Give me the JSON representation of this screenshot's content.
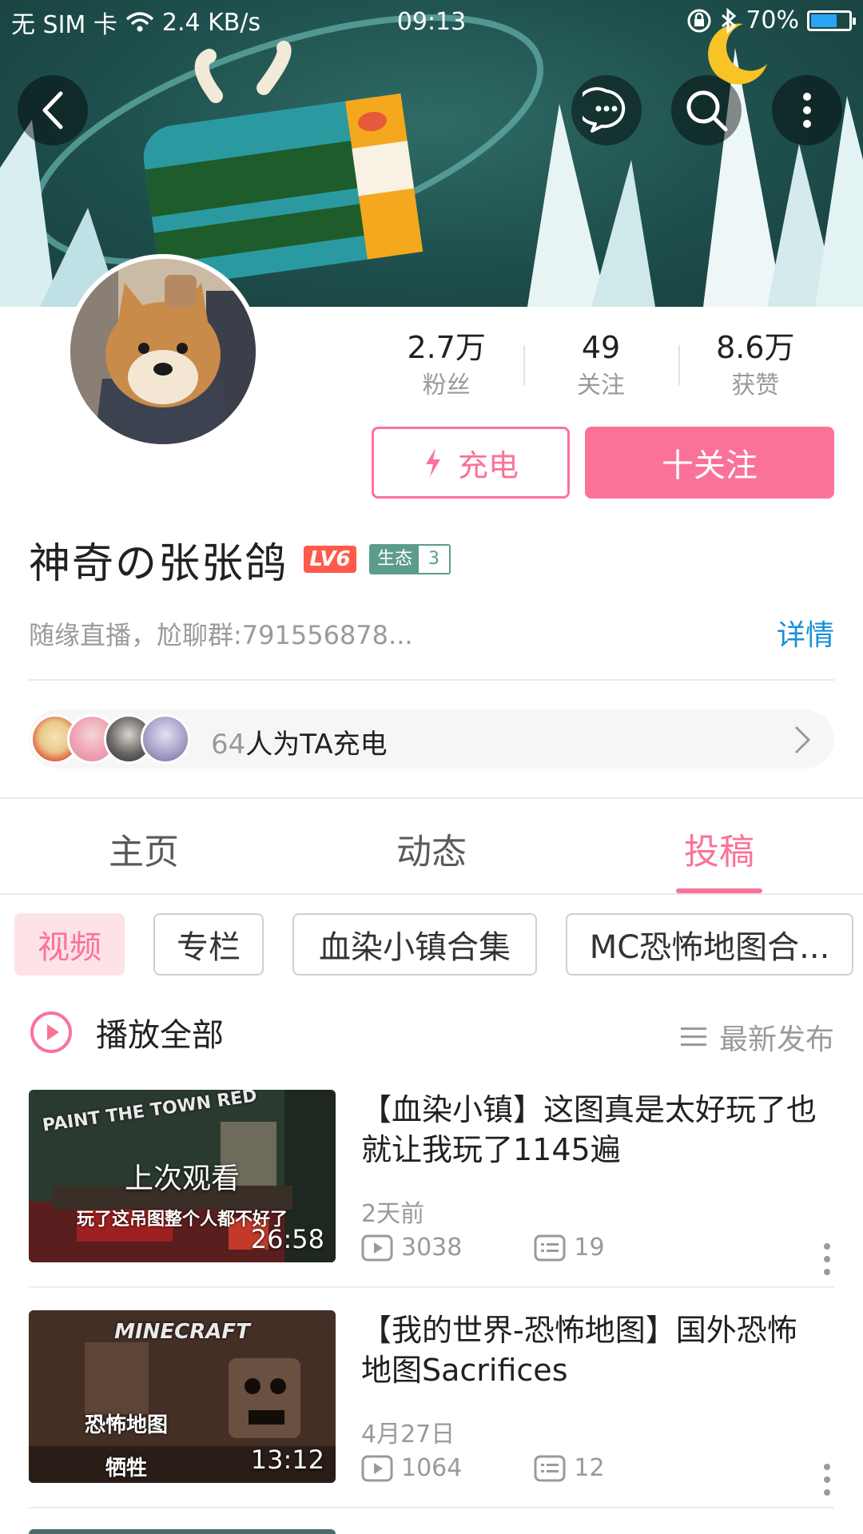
{
  "status_bar": {
    "carrier": "无 SIM 卡",
    "speed": "2.4 KB/s",
    "time": "09:13",
    "battery": "70%",
    "battery_level": 0.7
  },
  "profile": {
    "name": "神奇の张张鸽",
    "level": "LV6",
    "eco_label": "生态",
    "eco_value": "3",
    "bio": "随缘直播，尬聊群:791556878...",
    "detail_link": "详情",
    "stats": [
      {
        "value": "2.7万",
        "label": "粉丝"
      },
      {
        "value": "49",
        "label": "关注"
      },
      {
        "value": "8.6万",
        "label": "获赞"
      }
    ],
    "charge_button": "充电",
    "follow_button": "十关注",
    "charge_count": "64",
    "charge_suffix": "人为TA充电"
  },
  "tabs": [
    {
      "label": "主页"
    },
    {
      "label": "动态"
    },
    {
      "label": "投稿"
    }
  ],
  "filters": [
    {
      "label": "视频"
    },
    {
      "label": "专栏"
    },
    {
      "label": "血染小镇合集"
    },
    {
      "label": "MC恐怖地图合..."
    }
  ],
  "play_all": "播放全部",
  "sort_label": "最新发布",
  "videos": [
    {
      "title": "【血染小镇】这图真是太好玩了也就让我玩了1145遍",
      "date": "2天前",
      "plays": "3038",
      "danmaku": "19",
      "duration": "26:58",
      "overlay": "上次观看",
      "thumb_caption": "玩了这吊图整个人都不好了",
      "thumb_logo": "PAINT THE TOWN RED"
    },
    {
      "title": "【我的世界-恐怖地图】国外恐怖地图Sacrifices",
      "date": "4月27日",
      "plays": "1064",
      "danmaku": "12",
      "duration": "13:12",
      "thumb_logo": "MINECRAFT",
      "thumb_caption": "恐怖地图",
      "thumb_caption2": "牺牲"
    }
  ],
  "colors": {
    "accent": "#fb7299",
    "link": "#1a8fd6",
    "level_badge": "#ff5a4a",
    "eco_badge": "#5c9c8e"
  }
}
